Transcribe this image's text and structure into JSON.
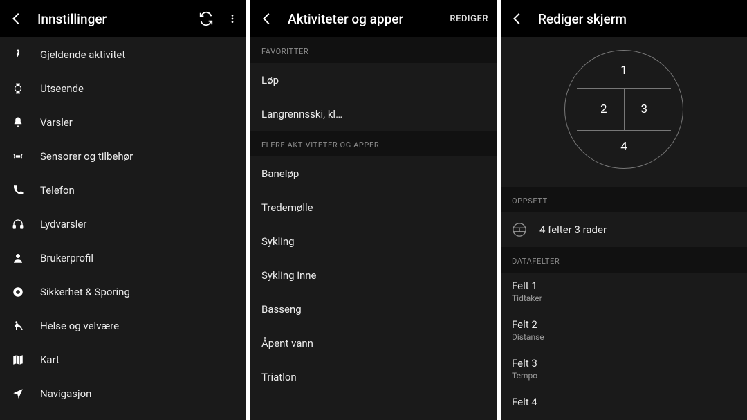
{
  "screen1": {
    "title": "Innstillinger",
    "items": [
      {
        "label": "Gjeldende aktivitet",
        "icon": "activity"
      },
      {
        "label": "Utseende",
        "icon": "watch"
      },
      {
        "label": "Varsler",
        "icon": "bell"
      },
      {
        "label": "Sensorer og tilbehør",
        "icon": "sensor"
      },
      {
        "label": "Telefon",
        "icon": "phone"
      },
      {
        "label": "Lydvarsler",
        "icon": "headphones"
      },
      {
        "label": "Brukerprofil",
        "icon": "user"
      },
      {
        "label": "Sikkerhet & Sporing",
        "icon": "shield"
      },
      {
        "label": "Helse og velvære",
        "icon": "health"
      },
      {
        "label": "Kart",
        "icon": "map"
      },
      {
        "label": "Navigasjon",
        "icon": "nav"
      }
    ]
  },
  "screen2": {
    "title": "Aktiviteter og apper",
    "action": "REDIGER",
    "sec_fav": "FAVORITTER",
    "favorites": [
      "Løp",
      "Langrennsski, kl…"
    ],
    "sec_more": "FLERE AKTIVITETER OG APPER",
    "more": [
      "Baneløp",
      "Tredemølle",
      "Sykling",
      "Sykling inne",
      "Basseng",
      "Åpent vann",
      "Triatlon"
    ]
  },
  "screen3": {
    "title": "Rediger skjerm",
    "dial": {
      "n1": "1",
      "n2": "2",
      "n3": "3",
      "n4": "4"
    },
    "sec_layout": "OPPSETT",
    "layout_label": "4 felter 3 rader",
    "sec_fields": "DATAFELTER",
    "fields": [
      {
        "title": "Felt 1",
        "sub": "Tidtaker"
      },
      {
        "title": "Felt 2",
        "sub": "Distanse"
      },
      {
        "title": "Felt 3",
        "sub": "Tempo"
      },
      {
        "title": "Felt 4",
        "sub": ""
      }
    ]
  }
}
